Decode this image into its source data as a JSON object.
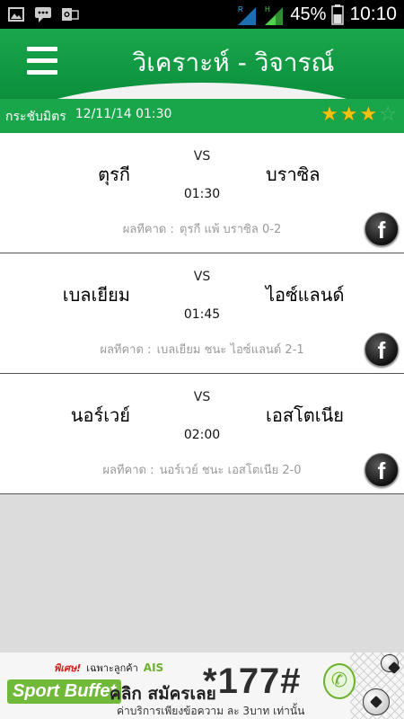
{
  "status_bar": {
    "battery_percent": "45%",
    "time": "10:10",
    "icons": [
      "image-icon",
      "chat-icon",
      "outlook-icon",
      "signal-r-icon",
      "signal-h-icon",
      "battery-icon"
    ]
  },
  "header": {
    "title": "วิเคราะห์ - วิจารณ์",
    "menu_icon": "hamburger-menu-icon"
  },
  "subbar": {
    "label": "กระชับมิตร",
    "datetime": "12/11/14 01:30",
    "rating_filled": 3,
    "rating_total": 4
  },
  "matches": [
    {
      "vs": "VS",
      "home": "ตุรกี",
      "away": "บราซิล",
      "time": "01:30",
      "prediction_label": "ผลทีคาด :",
      "prediction": "ตุรกี แพ้ บราซิล 0-2",
      "share_label": "f"
    },
    {
      "vs": "VS",
      "home": "เบลเยียม",
      "away": "ไอซ์แลนด์",
      "time": "01:45",
      "prediction_label": "ผลทีคาด :",
      "prediction": "เบลเยียม ชนะ ไอซ์แลนด์ 2-1",
      "share_label": "f"
    },
    {
      "vs": "VS",
      "home": "นอร์เวย์",
      "away": "เอสโตเนีย",
      "time": "02:00",
      "prediction_label": "ผลทีคาด :",
      "prediction": "นอร์เวย์ ชนะ เอสโตเนีย 2-0",
      "share_label": "f"
    }
  ],
  "banner": {
    "promo": "พิเศษ!",
    "promo_sub": "เฉพาะลูกค้า",
    "ais": "AIS",
    "sport": "Sport Buffet",
    "click": "คลิก สมัครเลย",
    "code": "*177#",
    "note": "ค่าบริการเพียงข้อความ ละ 3บาท เท่านั้น"
  },
  "colors": {
    "header_green": "#1aa64c",
    "star_gold": "#f4c20d",
    "banner_green": "#71b93a"
  }
}
